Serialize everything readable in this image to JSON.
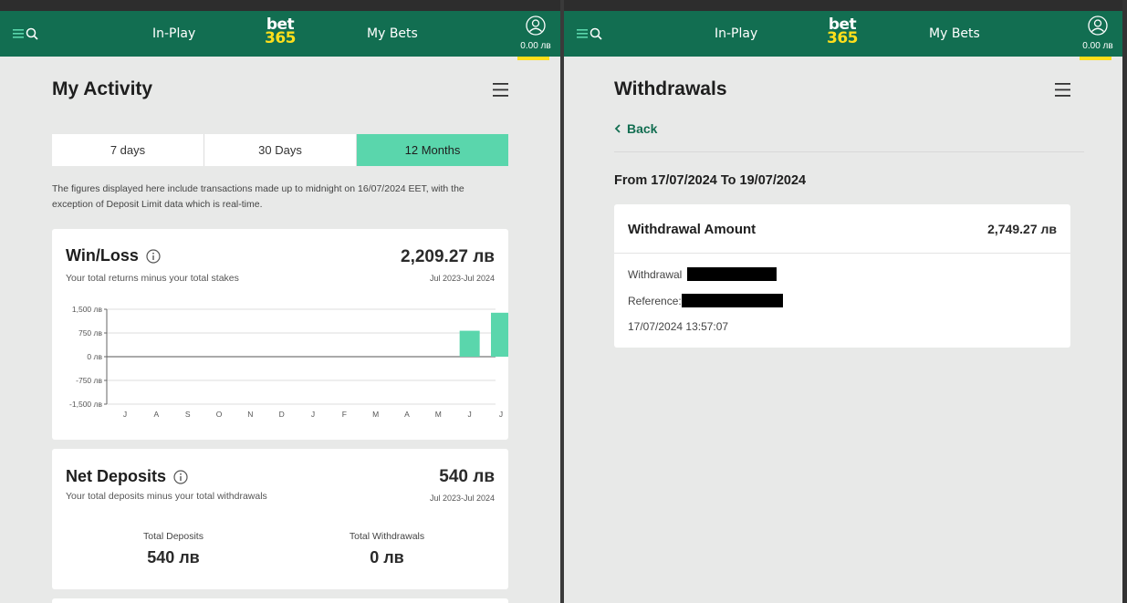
{
  "header": {
    "nav_inplay": "In-Play",
    "nav_mybets": "My Bets",
    "logo_line1": "bet",
    "logo_line2": "365",
    "balance": "0.00 лв"
  },
  "left": {
    "title": "My Activity",
    "tabs": [
      "7 days",
      "30 Days",
      "12 Months"
    ],
    "active_tab": "12 Months",
    "note": "The figures displayed here include transactions made up to midnight on 16/07/2024 EET, with the exception of Deposit Limit data which is real-time.",
    "winloss": {
      "title": "Win/Loss",
      "subtitle": "Your total returns minus your total stakes",
      "value": "2,209.27 лв",
      "range": "Jul 2023-Jul 2024"
    },
    "netdeposits": {
      "title": "Net Deposits",
      "subtitle": "Your total deposits minus your total withdrawals",
      "value": "540 лв",
      "range": "Jul 2023-Jul 2024",
      "total_deposits_label": "Total Deposits",
      "total_deposits_value": "540 лв",
      "total_withdrawals_label": "Total Withdrawals",
      "total_withdrawals_value": "0 лв"
    }
  },
  "chart_data": {
    "type": "bar",
    "categories": [
      "J",
      "A",
      "S",
      "O",
      "N",
      "D",
      "J",
      "F",
      "M",
      "A",
      "M",
      "J",
      "J"
    ],
    "values": [
      0,
      0,
      0,
      0,
      0,
      0,
      0,
      0,
      0,
      0,
      0,
      820,
      1390
    ],
    "yticks": [
      "1,500 лв",
      "750 лв",
      "0 лв",
      "-750 лв",
      "-1,500 лв"
    ],
    "ytick_values": [
      1500,
      750,
      0,
      -750,
      -1500
    ],
    "ylim": [
      -1500,
      1500
    ],
    "bar_color": "#5ad6ac"
  },
  "right": {
    "title": "Withdrawals",
    "back": "Back",
    "range": "From 17/07/2024 To 19/07/2024",
    "card": {
      "label": "Withdrawal Amount",
      "value": "2,749.27 лв",
      "withdrawal_label": "Withdrawal",
      "reference_label": "Reference:",
      "timestamp": "17/07/2024 13:57:07"
    }
  },
  "colors": {
    "brand_green": "#126e51",
    "accent_yellow": "#ffdf1b",
    "active_tab": "#5ad6ac"
  }
}
